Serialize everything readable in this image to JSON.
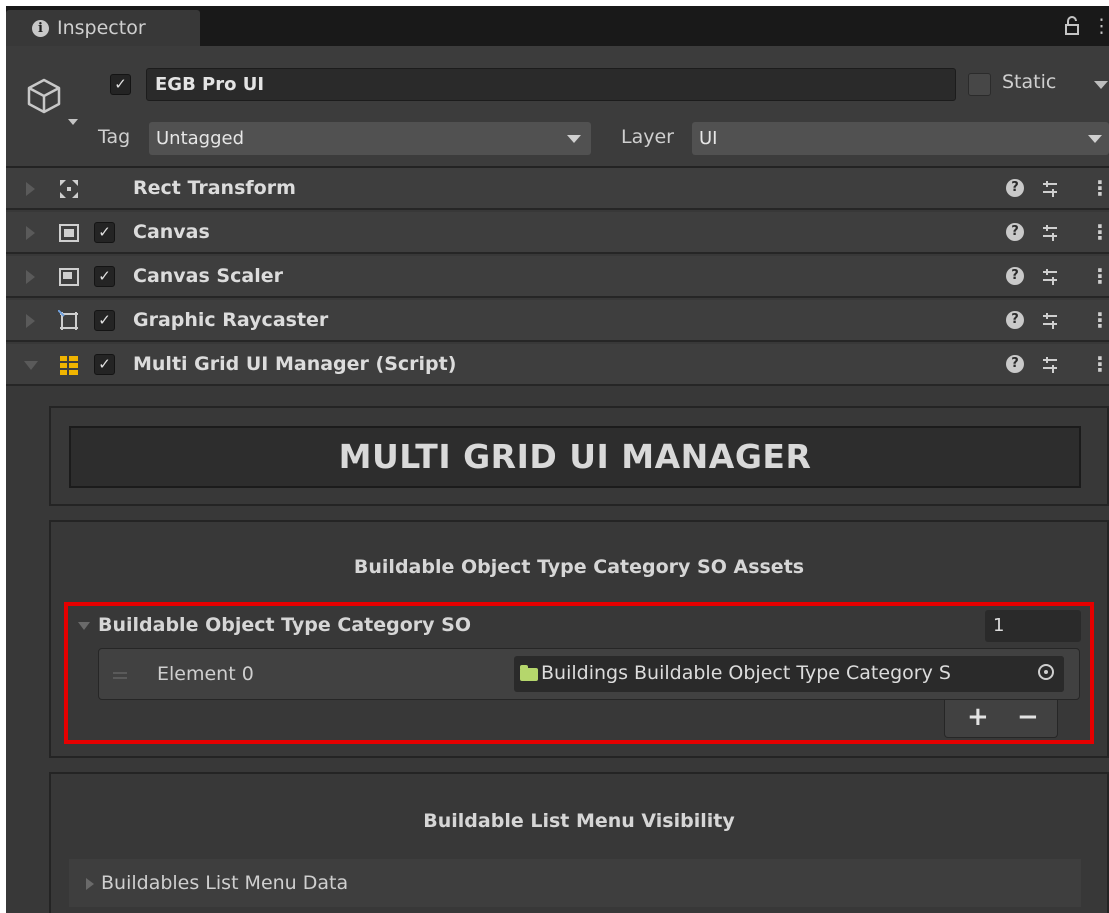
{
  "tab": {
    "title": "Inspector"
  },
  "header": {
    "object_name": "EGB Pro UI",
    "active": true,
    "static_label": "Static",
    "tag_label": "Tag",
    "tag_value": "Untagged",
    "layer_label": "Layer",
    "layer_value": "UI"
  },
  "components": [
    {
      "title": "Rect Transform",
      "icon": "rect-transform-icon",
      "has_checkbox": false
    },
    {
      "title": "Canvas",
      "icon": "canvas-icon",
      "has_checkbox": true
    },
    {
      "title": "Canvas Scaler",
      "icon": "canvas-scaler-icon",
      "has_checkbox": true
    },
    {
      "title": "Graphic Raycaster",
      "icon": "graphic-raycaster-icon",
      "has_checkbox": true
    },
    {
      "title": "Multi Grid UI Manager (Script)",
      "icon": "script-icon",
      "has_checkbox": true,
      "expanded": true
    }
  ],
  "script": {
    "banner": "MULTI GRID UI MANAGER",
    "assets_section": {
      "title": "Buildable Object Type Category SO Assets",
      "list_label": "Buildable Object Type Category SO",
      "count": "1",
      "elements": [
        {
          "label": "Element 0",
          "value": "Buildings Buildable Object Type Category S"
        }
      ],
      "add_label": "+",
      "remove_label": "−"
    },
    "visibility_section": {
      "title": "Buildable List Menu Visibility",
      "foldout_label": "Buildables List Menu Data"
    }
  },
  "colors": {
    "highlight": "#e60000",
    "panel_bg": "#383838",
    "folder": "#b5d66c"
  }
}
